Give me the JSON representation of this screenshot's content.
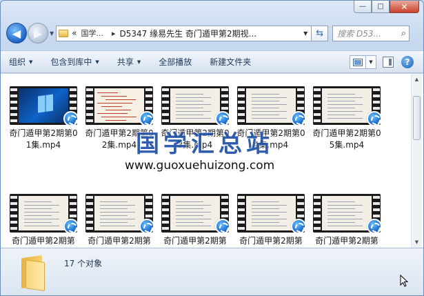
{
  "window": {
    "controls": {
      "minimize": "—",
      "maximize": "□",
      "close": "✕"
    }
  },
  "nav": {
    "back_icon": "back-arrow-icon",
    "forward_icon": "forward-arrow-icon",
    "address": {
      "prefix": "«",
      "crumb1": "国学...",
      "crumb_sep": "▸",
      "crumb2": "D5347 缘易先生 奇门遁甲第2期视..."
    },
    "search_placeholder": "搜索 D53..."
  },
  "toolbar": {
    "organize": "组织",
    "include_in_library": "包含到库中",
    "share": "共享",
    "play_all": "全部播放",
    "new_folder": "新建文件夹"
  },
  "files": [
    {
      "name": "奇门遁甲第2期第01集.mp4",
      "thumb": "windows-desktop"
    },
    {
      "name": "奇门遁甲第2期第02集.mp4",
      "thumb": "handwritten-chart"
    },
    {
      "name": "奇门遁甲第2期第03集.mp4",
      "thumb": "document"
    },
    {
      "name": "奇门遁甲第2期第04集.mp4",
      "thumb": "document"
    },
    {
      "name": "奇门遁甲第2期第05集.mp4",
      "thumb": "document"
    },
    {
      "name": "奇门遁甲第2期第",
      "thumb": "document"
    },
    {
      "name": "奇门遁甲第2期第",
      "thumb": "document"
    },
    {
      "name": "奇门遁甲第2期第",
      "thumb": "document"
    },
    {
      "name": "奇门遁甲第2期第",
      "thumb": "document"
    },
    {
      "name": "奇门遁甲第2期第",
      "thumb": "document"
    }
  ],
  "watermark": {
    "title": "国学汇总站",
    "url": "www.guoxuehuizong.com"
  },
  "status": {
    "item_count": "17 个对象"
  }
}
